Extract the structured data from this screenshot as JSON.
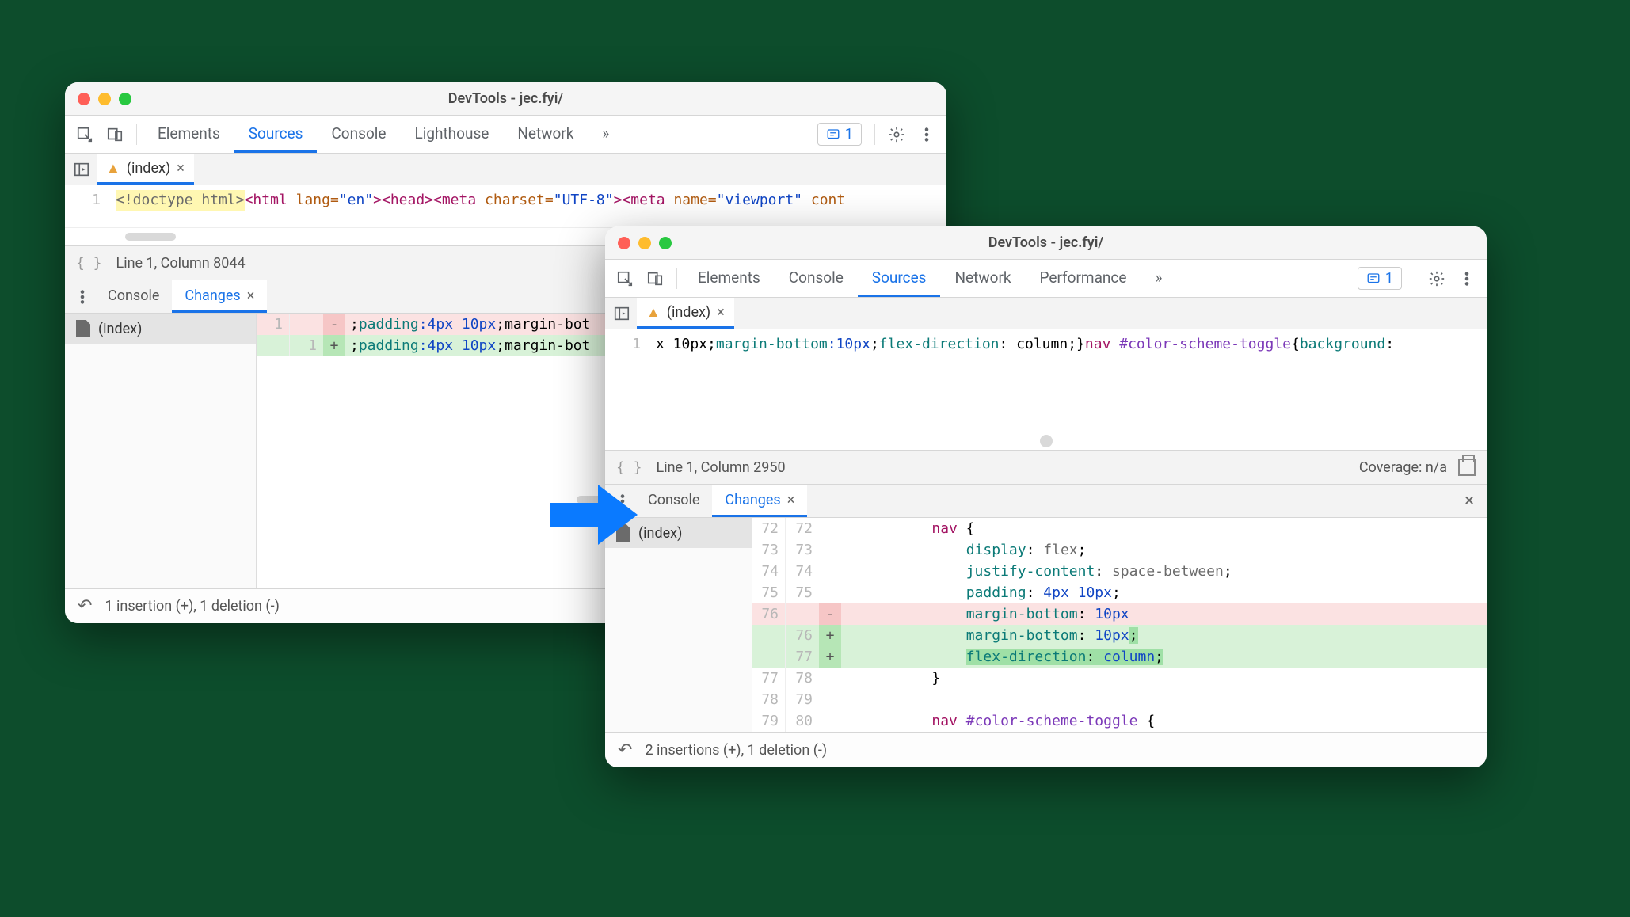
{
  "window1": {
    "title": "DevTools - jec.fyi/",
    "tabs": [
      "Elements",
      "Sources",
      "Console",
      "Lighthouse",
      "Network"
    ],
    "active_tab": "Sources",
    "overflow": "»",
    "issues_count": "1",
    "file_tab": "(index)",
    "code_line_num": "1",
    "code_tokens": {
      "doctype": "<!doctype html>",
      "html_open": "<html ",
      "lang_attr": "lang=",
      "lang_val": "\"en\"",
      "head_open": "><head>",
      "meta1_open": "<meta ",
      "charset_attr": "charset=",
      "charset_val": "\"UTF-8\"",
      "meta2_open": "><meta ",
      "name_attr": "name=",
      "name_val": "\"viewport\"",
      "cont_attr": " cont"
    },
    "status": "Line 1, Column 8044",
    "drawer": {
      "console": "Console",
      "changes": "Changes"
    },
    "file_list_item": "(index)",
    "diff": {
      "left1": "1",
      "right1": "1",
      "seg_pad_label": "padding",
      "seg_pad_val": ":4px 10px",
      "seg_mb_label": ";margin-bot"
    },
    "footer": "1 insertion (+), 1 deletion (-)"
  },
  "window2": {
    "title": "DevTools - jec.fyi/",
    "tabs": [
      "Elements",
      "Console",
      "Sources",
      "Network",
      "Performance"
    ],
    "active_tab": "Sources",
    "overflow": "»",
    "issues_count": "1",
    "file_tab": "(index)",
    "code_line_num": "1",
    "code_tokens": {
      "pre": "x 10px;",
      "mb_label": "margin-bottom",
      "mb_val": ":10px",
      "sep1": ";",
      "fd_label": "flex-direction",
      "fd_val": ": column",
      "sep2": ";}",
      "nav": "nav ",
      "sel": "#color-scheme-toggle",
      "brace": "{",
      "bg_label": "background",
      "bg_tail": ":"
    },
    "status": "Line 1, Column 2950",
    "coverage": "Coverage: n/a",
    "drawer": {
      "console": "Console",
      "changes": "Changes"
    },
    "file_list_item": "(index)",
    "diff_rows": [
      {
        "l": "72",
        "r": "72",
        "s": "",
        "c": [
          {
            "t": "nav ",
            "cls": "t-pink"
          },
          {
            "t": "{",
            "cls": ""
          }
        ]
      },
      {
        "l": "73",
        "r": "73",
        "s": "",
        "c": [
          {
            "t": "    display",
            "cls": "t-teal"
          },
          {
            "t": ": ",
            "cls": ""
          },
          {
            "t": "flex",
            "cls": "t-gray"
          },
          {
            "t": ";",
            "cls": ""
          }
        ]
      },
      {
        "l": "74",
        "r": "74",
        "s": "",
        "c": [
          {
            "t": "    justify-content",
            "cls": "t-teal"
          },
          {
            "t": ": ",
            "cls": ""
          },
          {
            "t": "space-between",
            "cls": "t-gray"
          },
          {
            "t": ";",
            "cls": ""
          }
        ]
      },
      {
        "l": "75",
        "r": "75",
        "s": "",
        "c": [
          {
            "t": "    padding",
            "cls": "t-teal"
          },
          {
            "t": ": ",
            "cls": ""
          },
          {
            "t": "4px 10px",
            "cls": "t-blue"
          },
          {
            "t": ";",
            "cls": ""
          }
        ]
      },
      {
        "l": "76",
        "r": "",
        "s": "-",
        "row": "del",
        "c": [
          {
            "t": "    margin-bottom",
            "cls": "t-teal"
          },
          {
            "t": ": ",
            "cls": ""
          },
          {
            "t": "10px",
            "cls": "t-blue"
          }
        ]
      },
      {
        "l": "",
        "r": "76",
        "s": "+",
        "row": "add",
        "c": [
          {
            "t": "    margin-bottom",
            "cls": "t-teal"
          },
          {
            "t": ": ",
            "cls": ""
          },
          {
            "t": "10px",
            "cls": "t-blue"
          },
          {
            "t": ";",
            "cls": "inline-add"
          }
        ]
      },
      {
        "l": "",
        "r": "77",
        "s": "+",
        "row": "add",
        "c": [
          {
            "t": "    ",
            "cls": ""
          },
          {
            "t": "flex-direction",
            "cls": "t-teal inline-add"
          },
          {
            "t": ": ",
            "cls": "inline-add"
          },
          {
            "t": "column",
            "cls": "t-blue inline-add"
          },
          {
            "t": ";",
            "cls": "inline-add"
          }
        ]
      },
      {
        "l": "77",
        "r": "78",
        "s": "",
        "c": [
          {
            "t": "}",
            "cls": ""
          }
        ]
      },
      {
        "l": "78",
        "r": "79",
        "s": "",
        "c": [
          {
            "t": "",
            "cls": ""
          }
        ]
      },
      {
        "l": "79",
        "r": "80",
        "s": "",
        "c": [
          {
            "t": "nav ",
            "cls": "t-pink"
          },
          {
            "t": "#color-scheme-toggle ",
            "cls": "t-purple"
          },
          {
            "t": "{",
            "cls": ""
          }
        ]
      }
    ],
    "footer": "2 insertions (+), 1 deletion (-)"
  }
}
